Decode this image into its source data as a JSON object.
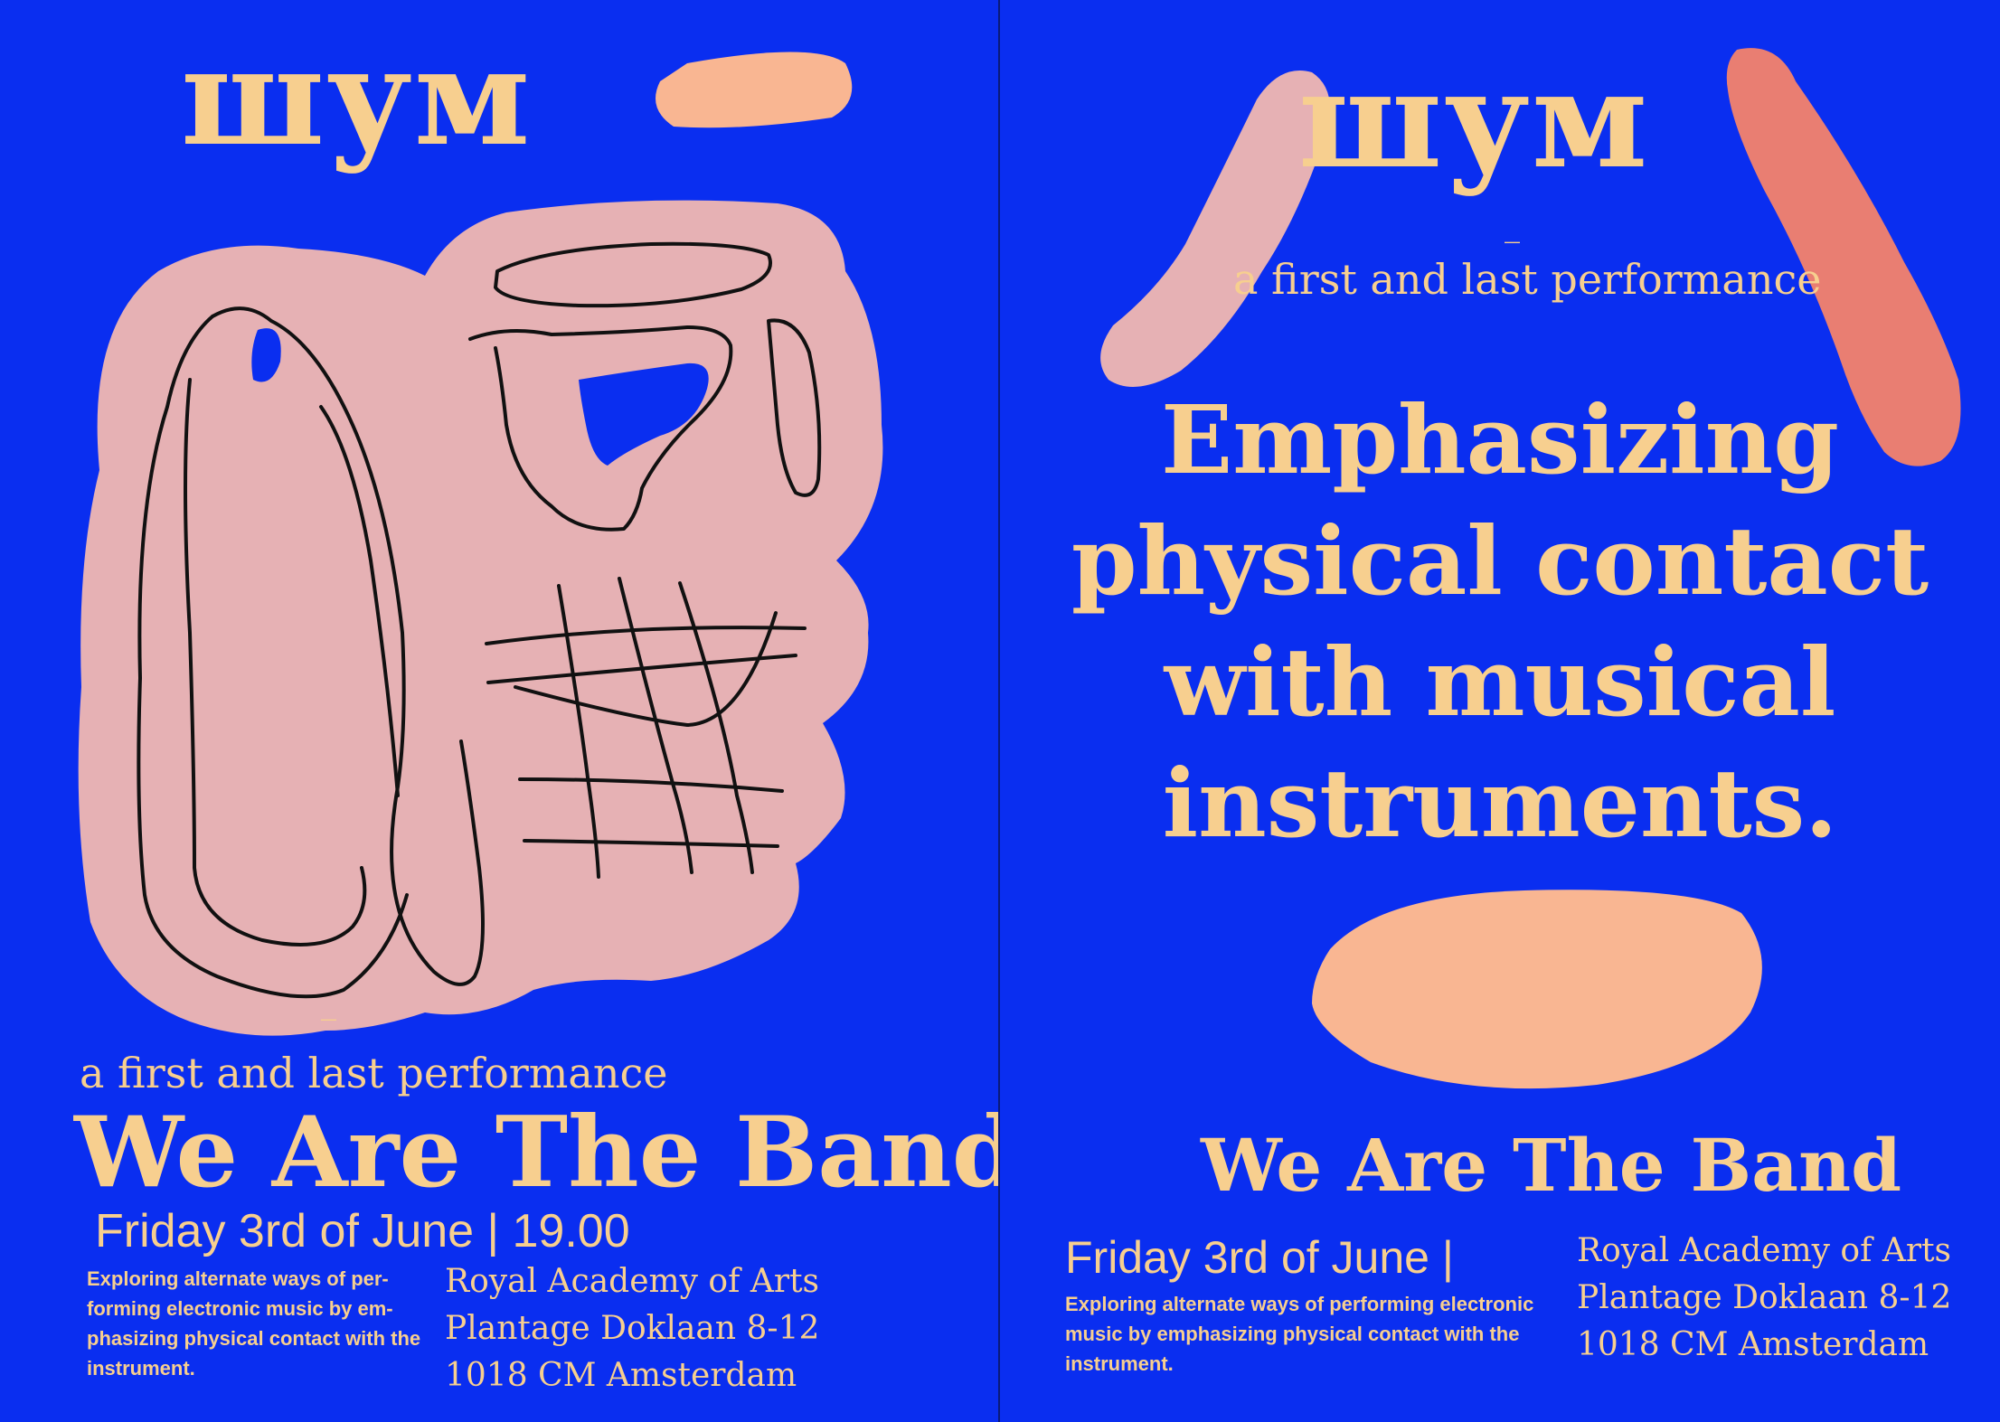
{
  "colors": {
    "background": "#0a2ef0",
    "text": "#f7cf8f",
    "pink_blob": "#e6b1b4",
    "peach_blob": "#f9b692",
    "salmon_blob": "#e97e72",
    "line": "#111111"
  },
  "left": {
    "logo": "шум",
    "dash": "_",
    "subtitle": "a first and last performance",
    "band": "We Are The Band",
    "date": "Friday 3rd of June | 19.00",
    "blurb": "Exploring alternate ways of per-forming electronic music by em-phasizing physical contact with the instrument.",
    "venue": [
      "Royal Academy of Arts",
      "Plantage Doklaan 8-12",
      "1018 CM Amsterdam"
    ]
  },
  "right": {
    "logo": "шум",
    "dash": "_",
    "subtitle": "a first and last performance",
    "headline": "Emphasizing physical contact with musical instruments.",
    "band": "We Are The Band",
    "date": "Friday 3rd of June |",
    "blurb": "Exploring alternate ways of performing electronic music by emphasizing physical contact with the instrument.",
    "venue": [
      "Royal Academy of Arts",
      "Plantage Doklaan 8-12",
      "1018 CM Amsterdam"
    ]
  }
}
